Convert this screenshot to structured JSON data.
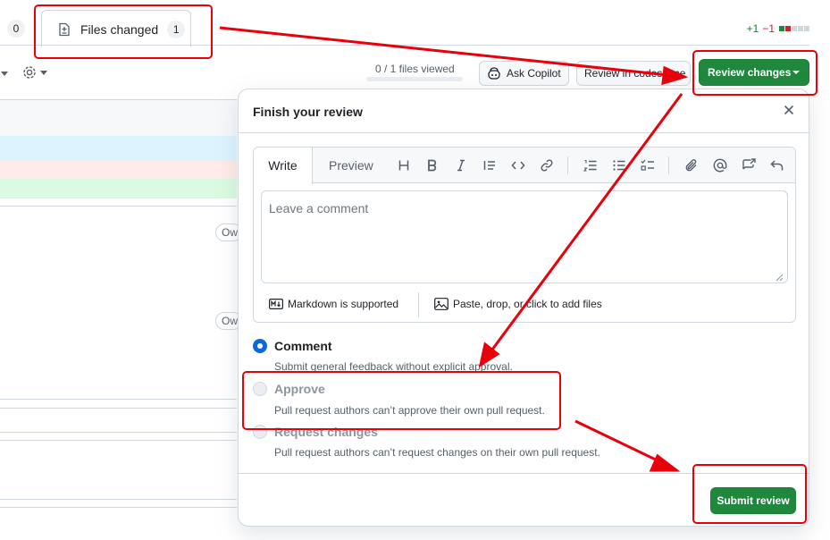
{
  "tabs": {
    "prev_count": "0",
    "files_changed_label": "Files changed",
    "files_changed_count": "1"
  },
  "diffstat": {
    "added": "+1",
    "removed": "−1"
  },
  "toolbar": {
    "files_viewed": "0 / 1 files viewed",
    "files_viewed_progress": 0,
    "ask_copilot": "Ask Copilot",
    "review_codespace": "Review in codespace",
    "review_changes": "Review changes"
  },
  "background": {
    "owner_label": "Ow"
  },
  "modal": {
    "title": "Finish your review",
    "editor": {
      "tab_write": "Write",
      "tab_preview": "Preview",
      "placeholder": "Leave a comment",
      "markdown_note": "Markdown is supported",
      "attach_note": "Paste, drop, or click to add files"
    },
    "options": [
      {
        "label": "Comment",
        "desc": "Submit general feedback without explicit approval.",
        "selected": true,
        "disabled": false
      },
      {
        "label": "Approve",
        "desc": "Pull request authors can’t approve their own pull request.",
        "selected": false,
        "disabled": true
      },
      {
        "label": "Request changes",
        "desc": "Pull request authors can’t request changes on their own pull request.",
        "selected": false,
        "disabled": true
      }
    ],
    "submit": "Submit review"
  },
  "colors": {
    "primary_green": "#1f883d",
    "annotation_red": "#e8000b",
    "accent_blue": "#0969da"
  }
}
